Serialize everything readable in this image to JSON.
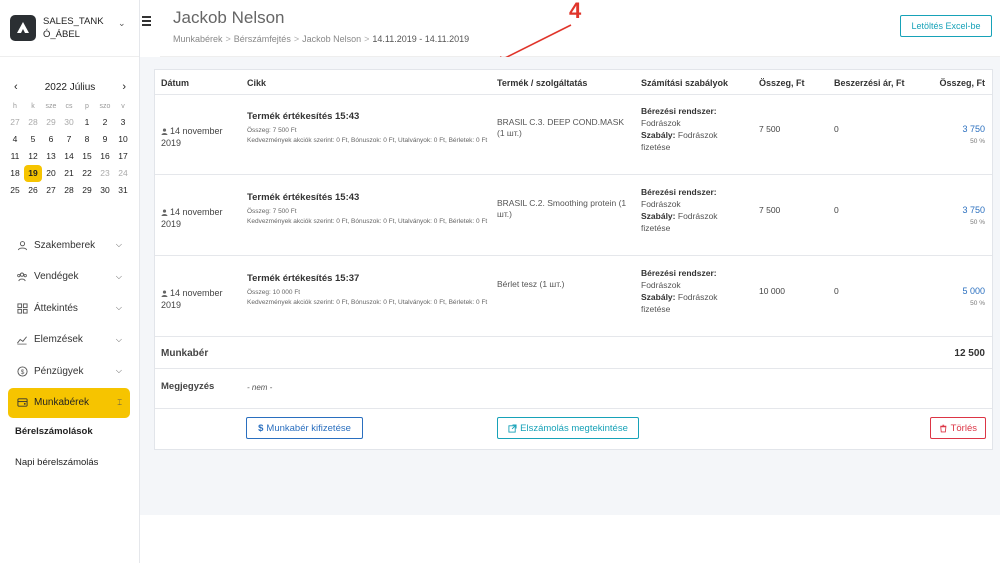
{
  "brand": {
    "name": "SALES_TANKÓ_ÁBEL"
  },
  "calendar": {
    "title": "2022 Július",
    "weekdays": [
      "h",
      "k",
      "sze",
      "cs",
      "p",
      "szo",
      "v"
    ],
    "weeks": [
      [
        "27",
        "28",
        "29",
        "30",
        "1",
        "2",
        "3"
      ],
      [
        "4",
        "5",
        "6",
        "7",
        "8",
        "9",
        "10"
      ],
      [
        "11",
        "12",
        "13",
        "14",
        "15",
        "16",
        "17"
      ],
      [
        "18",
        "19",
        "20",
        "21",
        "22",
        "23",
        "24"
      ],
      [
        "25",
        "26",
        "27",
        "28",
        "29",
        "30",
        "31"
      ]
    ],
    "selected": "19"
  },
  "nav": {
    "items": [
      {
        "label": "Szakemberek",
        "icon": "person-icon"
      },
      {
        "label": "Vendégek",
        "icon": "people-icon"
      },
      {
        "label": "Áttekintés",
        "icon": "grid-icon"
      },
      {
        "label": "Elemzések",
        "icon": "chart-icon"
      },
      {
        "label": "Pénzügyek",
        "icon": "dollar-icon"
      },
      {
        "label": "Munkabérek",
        "icon": "wallet-icon"
      }
    ],
    "sub_items": [
      "Bérelszámolások",
      "Napi bérelszámolás"
    ]
  },
  "header": {
    "title": "Jackob Nelson",
    "breadcrumb": [
      "Munkabérek",
      "Bérszámfejtés",
      "Jackob Nelson",
      "14.11.2019 - 14.11.2019"
    ],
    "excel_button": "Letöltés Excel-be"
  },
  "annotation": {
    "number": "4",
    "color": "#e0352b"
  },
  "table": {
    "columns": [
      "Dátum",
      "Cikk",
      "Termék / szolgáltatás",
      "Számítási szabályok",
      "Összeg, Ft",
      "Beszerzési ár, Ft",
      "Összeg, Ft"
    ],
    "rows": [
      {
        "date": "14 november 2019",
        "title": "Termék értékesítés 15:43",
        "amount_line": "Összeg: 7 500 Ft",
        "details": "Kedvezmények akciók szerint: 0 Ft, Bónuszok: 0 Ft, Utalványok: 0 Ft, Bérletek: 0 Ft",
        "product": "BRASIL C.3. DEEP COND.MASK (1 шт.)",
        "rule_system_label": "Bérezési rendszer:",
        "rule_system": "Fodrászok",
        "rule_label": "Szabály:",
        "rule": "Fodrászok fizetése",
        "amount": "7 500",
        "purchase": "0",
        "total": "3 750",
        "percent": "50 %"
      },
      {
        "date": "14 november 2019",
        "title": "Termék értékesítés 15:43",
        "amount_line": "Összeg: 7 500 Ft",
        "details": "Kedvezmények akciók szerint: 0 Ft, Bónuszok: 0 Ft, Utalványok: 0 Ft, Bérletek: 0 Ft",
        "product": "BRASIL C.2. Smoothing protein (1 шт.)",
        "rule_system_label": "Bérezési rendszer:",
        "rule_system": "Fodrászok",
        "rule_label": "Szabály:",
        "rule": "Fodrászok fizetése",
        "amount": "7 500",
        "purchase": "0",
        "total": "3 750",
        "percent": "50 %"
      },
      {
        "date": "14 november 2019",
        "title": "Termék értékesítés 15:37",
        "amount_line": "Összeg: 10 000 Ft",
        "details": "Kedvezmények akciók szerint: 0 Ft, Bónuszok: 0 Ft, Utalványok: 0 Ft, Bérletek: 0 Ft",
        "product": "Bérlet tesz (1 шт.)",
        "rule_system_label": "Bérezési rendszer:",
        "rule_system": "Fodrászok",
        "rule_label": "Szabály:",
        "rule": "Fodrászok fizetése",
        "amount": "10 000",
        "purchase": "0",
        "total": "5 000",
        "percent": "50 %"
      }
    ]
  },
  "summary": {
    "label": "Munkabér",
    "value": "12 500"
  },
  "note": {
    "label": "Megjegyzés",
    "value": "- nem -"
  },
  "actions": {
    "pay": "Munkabér kifizetése",
    "view": "Elszámolás megtekintése",
    "delete": "Törlés"
  }
}
